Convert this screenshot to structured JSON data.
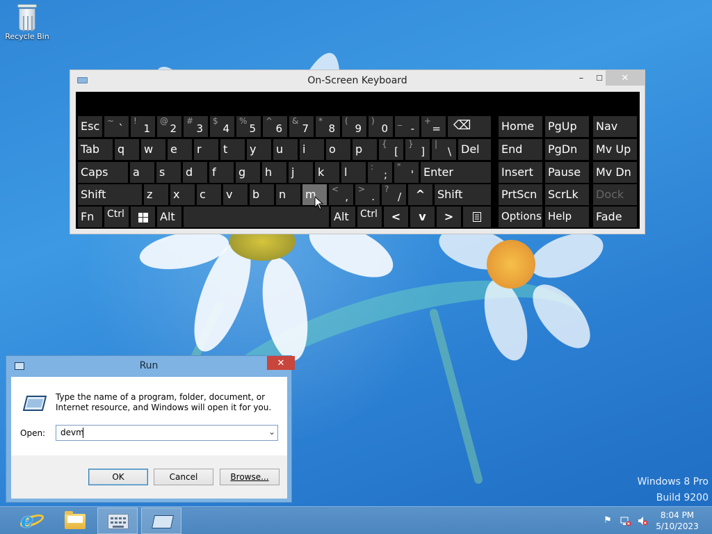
{
  "desktop": {
    "recycle_bin_label": "Recycle Bin",
    "watermark_line1": "Windows 8 Pro",
    "watermark_line2": "Build 9200"
  },
  "osk": {
    "title": "On-Screen Keyboard",
    "minimize": "–",
    "maximize": "☐",
    "close": "✕",
    "keys": {
      "esc": "Esc",
      "backquote_top": "~",
      "backquote": "`",
      "k1_top": "!",
      "k1": "1",
      "k2_top": "@",
      "k2": "2",
      "k3_top": "#",
      "k3": "3",
      "k4_top": "$",
      "k4": "4",
      "k5_top": "%",
      "k5": "5",
      "k6_top": "^",
      "k6": "6",
      "k7_top": "&",
      "k7": "7",
      "k8_top": "*",
      "k8": "8",
      "k9_top": "(",
      "k9": "9",
      "k0_top": ")",
      "k0": "0",
      "minus_top": "_",
      "minus": "-",
      "equal_top": "+",
      "equal": "=",
      "backspace": "⌫",
      "tab": "Tab",
      "q": "q",
      "w": "w",
      "e": "e",
      "r": "r",
      "t": "t",
      "y": "y",
      "u": "u",
      "i": "i",
      "o": "o",
      "p": "p",
      "lbracket_top": "{",
      "lbracket": "[",
      "rbracket_top": "}",
      "rbracket": "]",
      "backslash_top": "|",
      "backslash": "\\",
      "del": "Del",
      "caps": "Caps",
      "a": "a",
      "s": "s",
      "d": "d",
      "f": "f",
      "g": "g",
      "h": "h",
      "j": "j",
      "k": "k",
      "l": "l",
      "semicolon_top": ":",
      "semicolon": ";",
      "quote_top": "\"",
      "quote": "'",
      "enter": "Enter",
      "shift": "Shift",
      "z": "z",
      "x": "x",
      "c": "c",
      "v": "v",
      "b": "b",
      "n": "n",
      "m": "m",
      "comma_top": "<",
      "comma": ",",
      "period_top": ">",
      "period": ".",
      "slash_top": "?",
      "slash": "/",
      "up": "^",
      "shift_right": "Shift",
      "fn": "Fn",
      "ctrl": "Ctrl",
      "alt": "Alt",
      "alt_right": "Alt",
      "ctrl_right": "Ctrl",
      "left": "<",
      "down": "v",
      "right": ">",
      "home": "Home",
      "pgup": "PgUp",
      "nav": "Nav",
      "end": "End",
      "pgdn": "PgDn",
      "mvup": "Mv Up",
      "insert": "Insert",
      "pause": "Pause",
      "mvdn": "Mv Dn",
      "prtscn": "PrtScn",
      "scrlk": "ScrLk",
      "dock": "Dock",
      "options": "Options",
      "help": "Help",
      "fade": "Fade"
    }
  },
  "run": {
    "title": "Run",
    "close": "✕",
    "description": "Type the name of a program, folder, document, or Internet resource, and Windows will open it for you.",
    "open_label": "Open:",
    "open_value": "devm",
    "ok": "OK",
    "cancel": "Cancel",
    "browse": "Browse..."
  },
  "taskbar": {
    "time": "8:04 PM",
    "date": "5/10/2023"
  }
}
